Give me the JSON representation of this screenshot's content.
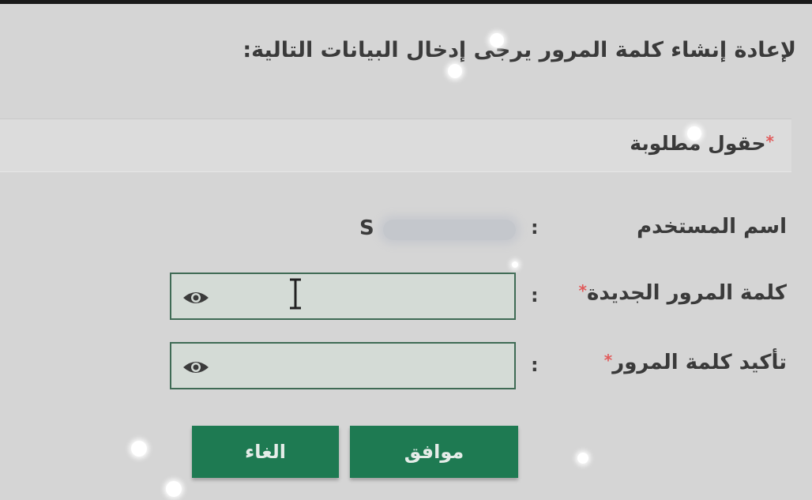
{
  "form": {
    "instruction": "لإعادة إنشاء كلمة المرور يرجى إدخال البيانات التالية:",
    "required_note": "حقول مطلوبة",
    "required_marker": "*",
    "colon": ":",
    "username": {
      "label": "اسم المستخدم",
      "value_prefix": "S"
    },
    "new_password": {
      "label": "كلمة المرور الجديدة",
      "value": "",
      "toggle_icon": "eye-icon"
    },
    "confirm_password": {
      "label": "تأكيد كلمة المرور",
      "value": "",
      "toggle_icon": "eye-icon"
    }
  },
  "buttons": {
    "ok_label": "موافق",
    "cancel_label": "الغاء"
  },
  "colors": {
    "button_green": "#1e7a52",
    "field_border": "#3f6b55",
    "required_asterisk": "#e15b5b"
  }
}
